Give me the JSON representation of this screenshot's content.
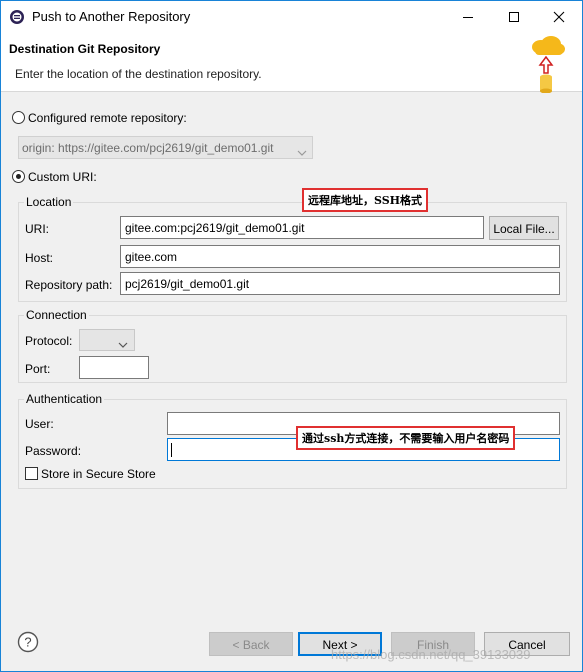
{
  "window": {
    "title": "Push to Another Repository"
  },
  "header": {
    "title": "Destination Git Repository",
    "description": "Enter the location of the destination repository."
  },
  "configured_remote": {
    "label": "Configured remote repository:",
    "selected": "origin: https://gitee.com/pcj2619/git_demo01.git"
  },
  "custom_uri": {
    "label": "Custom URI:"
  },
  "location": {
    "group_title": "Location",
    "uri_label": "URI:",
    "uri_value": "gitee.com:pcj2619/git_demo01.git",
    "local_file_button": "Local File...",
    "host_label": "Host:",
    "host_value": "gitee.com",
    "repo_path_label": "Repository path:",
    "repo_path_value": "pcj2619/git_demo01.git"
  },
  "connection": {
    "group_title": "Connection",
    "protocol_label": "Protocol:",
    "protocol_value": "",
    "port_label": "Port:",
    "port_value": ""
  },
  "authentication": {
    "group_title": "Authentication",
    "user_label": "User:",
    "user_value": "",
    "password_label": "Password:",
    "password_value": "",
    "store_label": "Store in Secure Store"
  },
  "annotations": {
    "remote_note": "远程库地址，SSH格式",
    "ssh_note": "通过ssh方式连接，不需要输入用户名密码"
  },
  "buttons": {
    "back": "< Back",
    "next": "Next >",
    "finish": "Finish",
    "cancel": "Cancel"
  },
  "watermark": "https://blog.csdn.net/qq_39133039",
  "colors": {
    "accent": "#0078d7",
    "annotation_border": "#e03030"
  },
  "icons": [
    "app-icon",
    "minimize-icon",
    "maximize-icon",
    "close-icon",
    "cloud-upload-icon",
    "chevron-down-icon",
    "help-icon"
  ]
}
